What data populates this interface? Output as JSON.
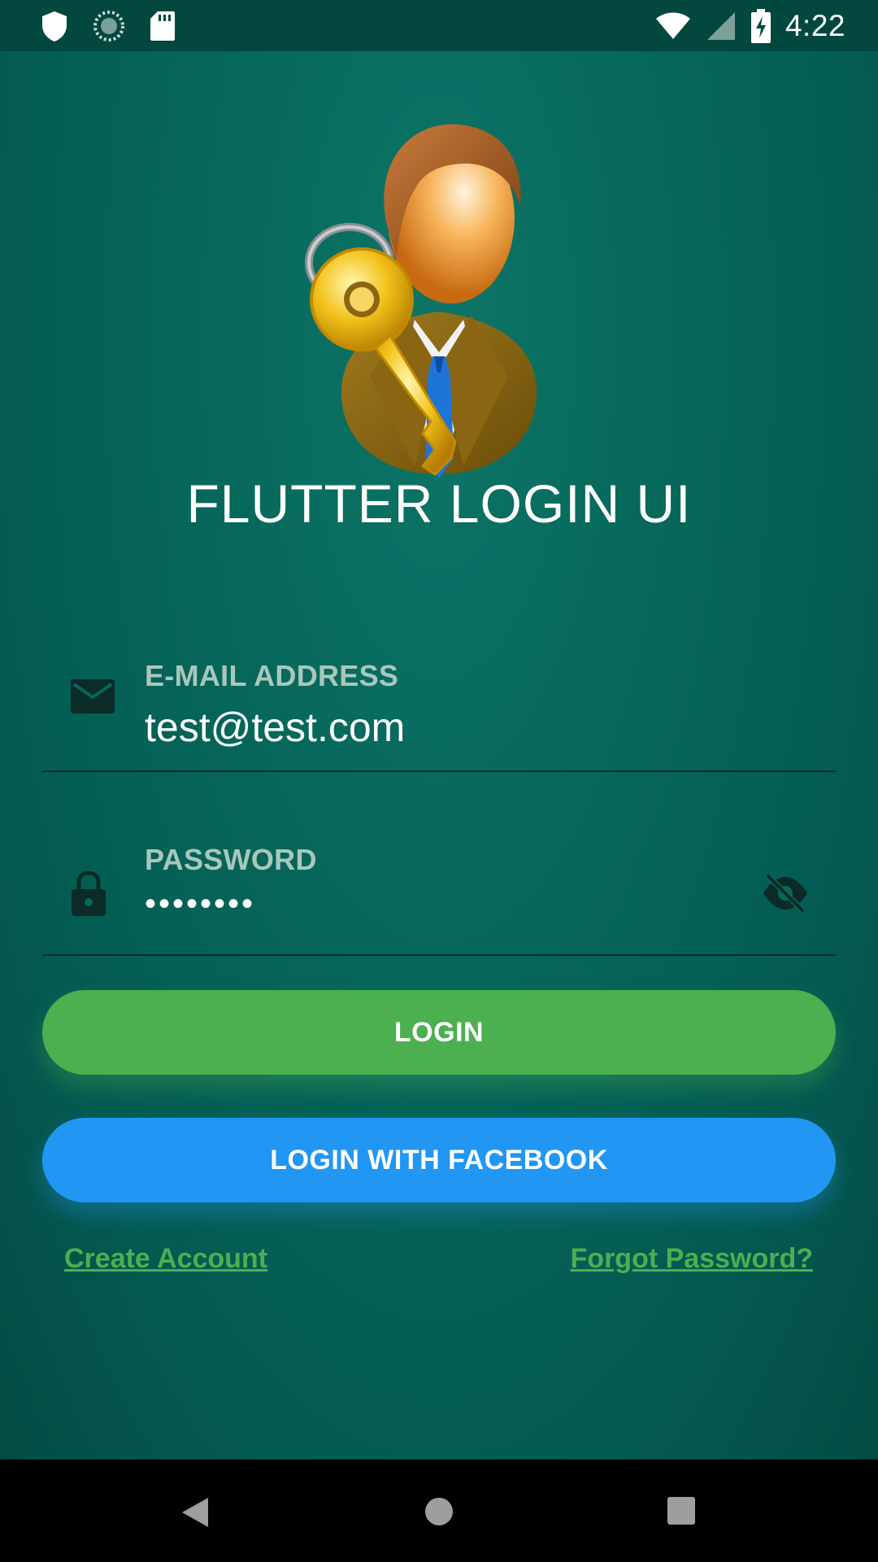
{
  "status_bar": {
    "time": "4:22",
    "left_icons": [
      "shield-icon",
      "sync-icon",
      "sd-card-icon"
    ],
    "right_icons": [
      "wifi-icon",
      "signal-icon",
      "battery-charging-icon"
    ]
  },
  "app": {
    "title": "FLUTTER LOGIN UI",
    "logo": "user-key-logo",
    "colors": {
      "background": "#06685b",
      "login_button": "#4caf50",
      "facebook_button": "#2196f3",
      "link": "#4caf50",
      "label": "#a9c7bd"
    }
  },
  "form": {
    "email": {
      "label": "E-MAIL ADDRESS",
      "value": "test@test.com",
      "icon": "mail-icon"
    },
    "password": {
      "label": "PASSWORD",
      "value": "••••••••",
      "icon": "lock-icon",
      "toggle_icon": "visibility-off-icon"
    }
  },
  "buttons": {
    "login": "LOGIN",
    "facebook": "LOGIN WITH FACEBOOK"
  },
  "links": {
    "create_account": "Create Account",
    "forgot_password": "Forgot Password?"
  },
  "nav_bar": {
    "icons": [
      "back-icon",
      "home-icon",
      "recents-icon"
    ]
  }
}
